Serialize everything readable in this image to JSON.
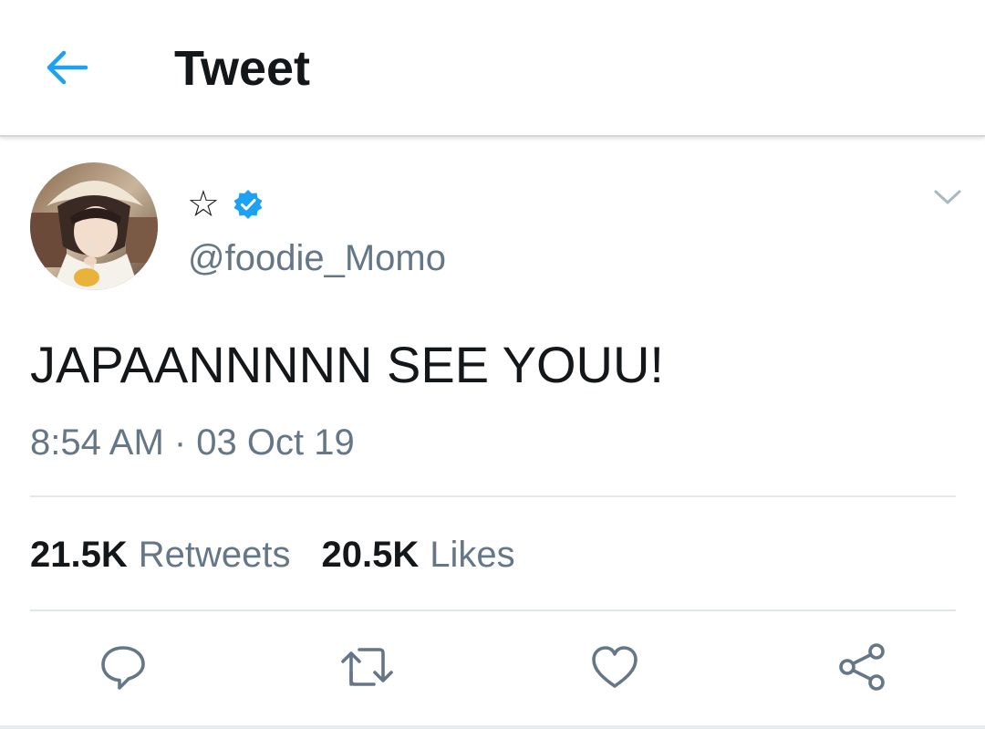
{
  "header": {
    "title": "Tweet",
    "back_icon": "arrow-left-icon"
  },
  "tweet": {
    "display_name": "☆",
    "verified_icon": "verified-badge-icon",
    "handle": "@foodie_Momo",
    "text": "JAPAANNNNN SEE YOUU!",
    "timestamp": "8:54 AM · 03 Oct 19",
    "menu_icon": "chevron-down-icon"
  },
  "stats": {
    "retweets_count": "21.5K",
    "retweets_label": "Retweets",
    "likes_count": "20.5K",
    "likes_label": "Likes"
  },
  "actions": [
    {
      "name": "reply",
      "icon": "reply-icon"
    },
    {
      "name": "retweet",
      "icon": "retweet-icon"
    },
    {
      "name": "like",
      "icon": "heart-icon"
    },
    {
      "name": "share",
      "icon": "share-icon"
    }
  ],
  "colors": {
    "accent": "#1da1f2",
    "text": "#14171a",
    "secondary_text": "#657786",
    "divider": "#e1e8ed"
  }
}
